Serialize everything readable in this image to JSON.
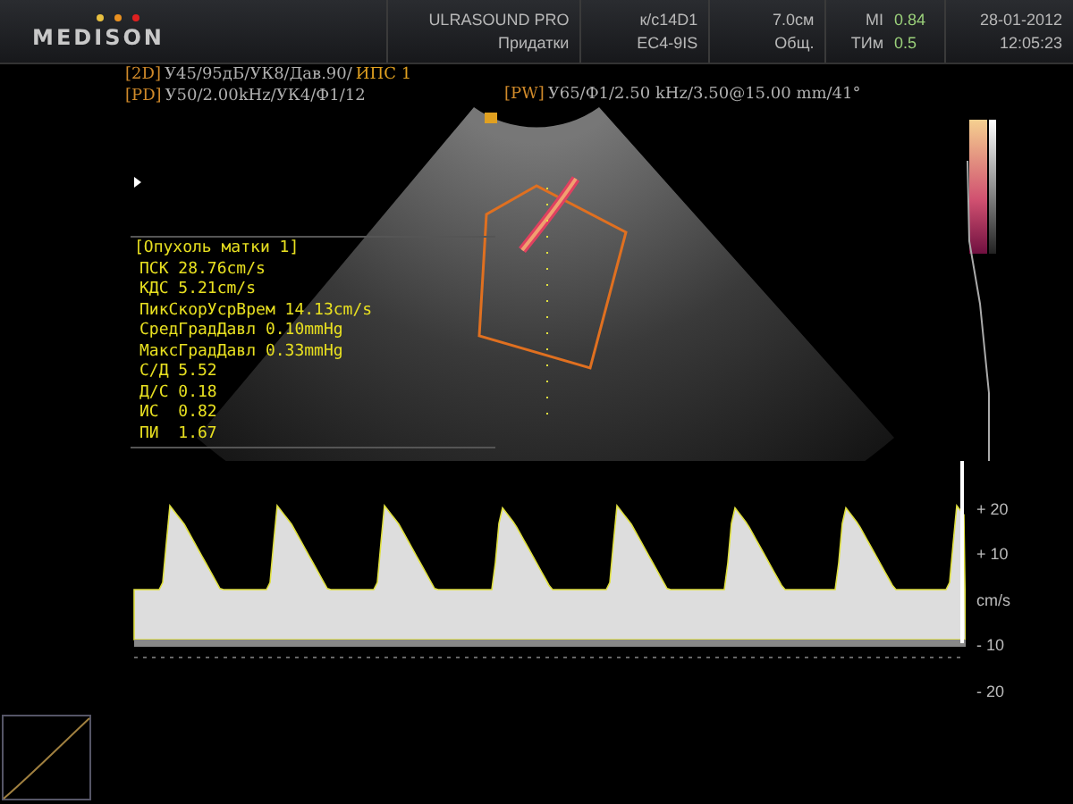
{
  "header": {
    "logo": "MEDISON",
    "cells": [
      {
        "top": "ULRASOUND PRO",
        "bottom": "Придатки"
      },
      {
        "top": "к/с14D1",
        "bottom": "EC4-9IS"
      },
      {
        "top": "7.0см",
        "bottom": "Общ."
      },
      {
        "top_label": "MI",
        "top_value": "0.84",
        "bottom_label": "ТИм",
        "bottom_value": "0.5"
      },
      {
        "top": "28-01-2012",
        "bottom": "12:05:23"
      }
    ]
  },
  "params": [
    {
      "tag": "[2D]",
      "text": "У45/95дБ/УК8/Дав.90/",
      "accent": "ИПС 1"
    },
    {
      "tag": "[PD]",
      "text": "У50/2.00kHz/УК4/Ф1/12"
    }
  ],
  "pw": {
    "tag": "[PW]",
    "text": "У65/Ф1/2.50 kHz/3.50@15.00 mm/41°"
  },
  "measurements": {
    "title": "[Опухоль матки 1]",
    "lines": [
      "ПСК 28.76cm/s",
      "КДС 5.21cm/s",
      "ПикСкорУсрВрем 14.13cm/s",
      "СредГрадДавл 0.10mmHg",
      "МаксГрадДавл 0.33mmHg",
      "С/Д 5.52",
      "Д/С 0.18",
      "ИС  0.82",
      "ПИ  1.67"
    ]
  },
  "scale": [
    "+ 20",
    "+ 10",
    "cm/s",
    "- 10",
    "- 20"
  ]
}
